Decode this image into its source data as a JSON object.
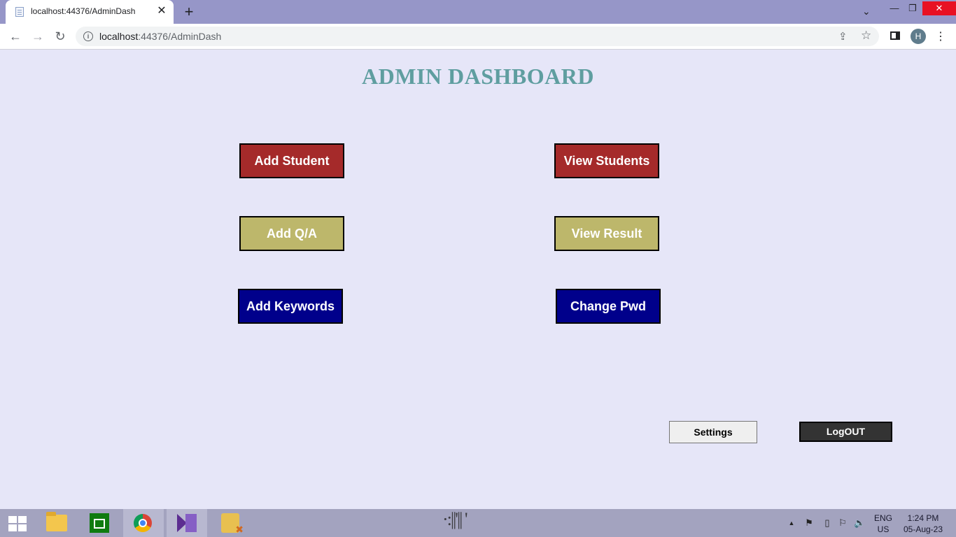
{
  "browser": {
    "tab_title": "localhost:44376/AdminDash",
    "url_host": "localhost",
    "url_rest": ":44376/AdminDash",
    "avatar_letter": "H",
    "icons": [
      "file-icon",
      "close-icon",
      "plus-icon",
      "chevron-down-icon",
      "minimize-icon",
      "restore-icon",
      "close-window-icon",
      "back-icon",
      "forward-icon",
      "reload-icon",
      "info-icon",
      "share-icon",
      "star-icon",
      "side-panel-icon",
      "menu-icon"
    ]
  },
  "page": {
    "title": "ADMIN DASHBOARD",
    "buttons": {
      "add_student": "Add Student",
      "view_students": "View Students",
      "add_qa": "Add Q/A",
      "view_result": "View Result",
      "add_keywords": "Add Keywords",
      "change_pwd": "Change Pwd"
    },
    "settings": "Settings",
    "logout": "LogOUT",
    "colors": {
      "background": "#e6e6f8",
      "title": "#5f9ea0",
      "red_button": "#a52a2a",
      "khaki_button": "#bdb76b",
      "navy_button": "#00008b",
      "logout_button": "#333333"
    }
  },
  "taskbar": {
    "lang_line1": "ENG",
    "lang_line2": "US",
    "time": "1:24 PM",
    "date": "05-Aug-23",
    "apps": [
      "windows-start-icon",
      "file-explorer-icon",
      "store-icon",
      "chrome-icon",
      "visual-studio-icon",
      "database-icon"
    ]
  }
}
